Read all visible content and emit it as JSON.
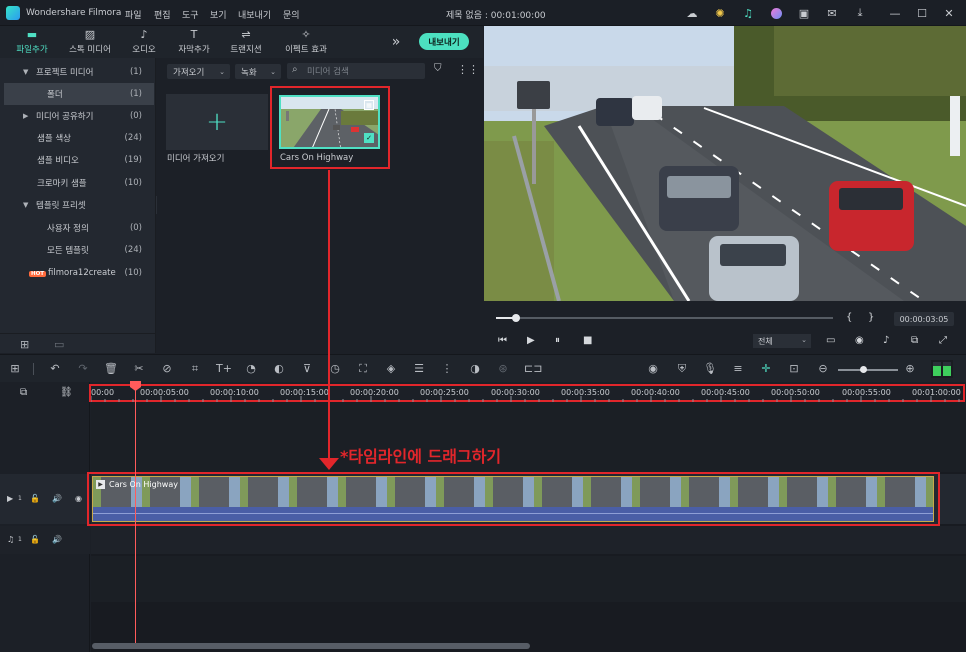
{
  "titlebar": {
    "app_name": "Wondershare Filmora",
    "menus": [
      "파일",
      "편집",
      "도구",
      "보기",
      "내보내기",
      "문의"
    ],
    "project_title": "제목 없음 : 00:01:00:00"
  },
  "toolbar": {
    "tabs": [
      {
        "label": "파일추가",
        "icon": "folder-icon"
      },
      {
        "label": "스톡 미디어",
        "icon": "image-icon"
      },
      {
        "label": "오디오",
        "icon": "music-icon"
      },
      {
        "label": "자막추가",
        "icon": "text-icon"
      },
      {
        "label": "트랜지션",
        "icon": "transition-icon"
      },
      {
        "label": "이펙트 효과",
        "icon": "effects-icon"
      }
    ],
    "export_label": "내보내기"
  },
  "sidebar": {
    "items": [
      {
        "label": "프로젝트 미디어",
        "count": "(1)"
      },
      {
        "label": "폴더",
        "count": "(1)"
      },
      {
        "label": "미디어 공유하기",
        "count": "(0)"
      },
      {
        "label": "샘플 색상",
        "count": "(24)"
      },
      {
        "label": "샘플 비디오",
        "count": "(19)"
      },
      {
        "label": "크로마키 샘플",
        "count": "(10)"
      },
      {
        "label": "템플릿 프리셋",
        "count": ""
      },
      {
        "label": "사용자 정의",
        "count": "(0)"
      },
      {
        "label": "모든 템플릿",
        "count": "(24)"
      },
      {
        "label": "filmora12create",
        "count": "(10)",
        "badge": "HOT"
      }
    ]
  },
  "media": {
    "import_dropdown": "가져오기",
    "record_dropdown": "녹화",
    "search_placeholder": "미디어 검색",
    "import_tile_label": "미디어 가져오기",
    "clip_label": "Cars On Highway"
  },
  "preview": {
    "timecode": "00:00:03:05",
    "quality": "전체",
    "mark_in": "{",
    "mark_out": "}"
  },
  "timeline": {
    "ruler": [
      "00:00",
      "00:00:05:00",
      "00:00:10:00",
      "00:00:15:00",
      "00:00:20:00",
      "00:00:25:00",
      "00:00:30:00",
      "00:00:35:00",
      "00:00:40:00",
      "00:00:45:00",
      "00:00:50:00",
      "00:00:55:00",
      "00:01:00:00"
    ],
    "clip_title": "Cars On Highway",
    "video_track_num": "1",
    "audio_track_num": "1"
  },
  "annotation": "*타임라인에 드래그하기",
  "colors": {
    "accent": "#4fe0c4",
    "annotation": "#e2262b",
    "clip": "#4a5ea6",
    "playhead": "#ff5b5b"
  }
}
